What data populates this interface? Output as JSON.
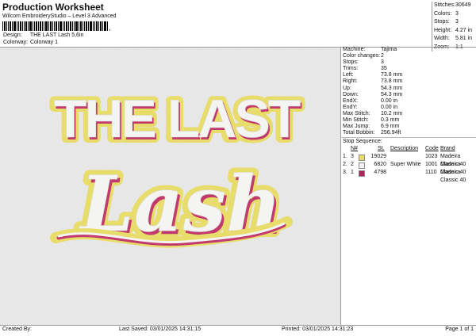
{
  "header": {
    "title": "Production Worksheet",
    "subtitle": "Wilcom EmbroideryStudio – Level 3 Advanced",
    "barcode_suffix": ","
  },
  "design_info": {
    "design_label": "Design:",
    "design_value": "THE LAST Lash 5,6in",
    "colorway_label": "Colorway:",
    "colorway_value": "Colorway 1"
  },
  "stats": [
    {
      "label": "Stitches:",
      "value": "30649"
    },
    {
      "label": "Colors:",
      "value": "3"
    },
    {
      "label": "Stops:",
      "value": "3"
    },
    {
      "label": "Height:",
      "value": "4.27 in"
    },
    {
      "label": "Width:",
      "value": "5.81 in"
    },
    {
      "label": "Zoom:",
      "value": "1:1"
    }
  ],
  "artwork": {
    "line1": "THE LAST",
    "line2": "Lash",
    "colors": {
      "gold": "#e8dc6a",
      "white": "#f4f4f2",
      "pink": "#c23a6d",
      "background": "#e9e9e9"
    }
  },
  "machine_info": [
    {
      "label": "Machine:",
      "value": "Tajima"
    },
    {
      "label": "Color changes:",
      "value": "2"
    },
    {
      "label": "Stops:",
      "value": "3"
    },
    {
      "label": "Trims:",
      "value": "35"
    },
    {
      "label": "Left:",
      "value": "73.8 mm"
    },
    {
      "label": "Right:",
      "value": "73.8 mm"
    },
    {
      "label": "Up:",
      "value": "54.3 mm"
    },
    {
      "label": "Down:",
      "value": "54.3 mm"
    },
    {
      "label": "EndX:",
      "value": "0.00 in"
    },
    {
      "label": "EndY:",
      "value": "0.00 in"
    },
    {
      "label": "Max Stitch:",
      "value": "10.2 mm"
    },
    {
      "label": "Min Stitch:",
      "value": "0.3 mm"
    },
    {
      "label": "Max Jump:",
      "value": "6.9 mm"
    },
    {
      "label": "Total Bobbin:",
      "value": "256.94ft"
    }
  ],
  "stop_sequence": {
    "title": "Stop Sequence:",
    "headers": {
      "n": "N#",
      "st": "St.",
      "desc": "Description",
      "code": "Code",
      "brand": "Brand"
    },
    "rows": [
      {
        "idx": "1.",
        "n": "3",
        "color": "#e8dc6a",
        "st": "19029",
        "desc": "",
        "code": "1023",
        "brand": "Madeira Classic 40"
      },
      {
        "idx": "2.",
        "n": "2",
        "color": "#f4f4f2",
        "st": "6820",
        "desc": "Super White",
        "code": "1001",
        "brand": "Madeira Classic 40"
      },
      {
        "idx": "3.",
        "n": "1",
        "color": "#b0245a",
        "st": "4798",
        "desc": "",
        "code": "1110",
        "brand": "Madeira Classic 40"
      }
    ]
  },
  "footer": {
    "created_by": "Created By:",
    "last_saved": "Last Saved: 03/01/2025 14:31:15",
    "printed": "Printed: 03/01/2025 14:31:23",
    "page": "Page 1 of 1"
  }
}
